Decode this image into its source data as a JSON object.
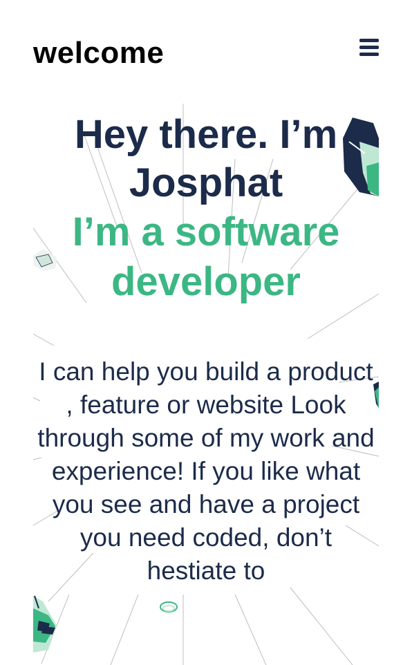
{
  "header": {
    "logo_text": "welcome",
    "menu_icon": "hamburger-menu-icon"
  },
  "hero": {
    "title": "Hey there. I’m Josphat",
    "subtitle": "I’m a software developer",
    "intro": "I can help you build a product , feature or website Look through some of my work and experience! If you like what you see and have a project you need coded, don’t hestiate to"
  },
  "colors": {
    "navy": "#1c2b4a",
    "green": "#3cb784",
    "line": "#bdbdbd"
  }
}
